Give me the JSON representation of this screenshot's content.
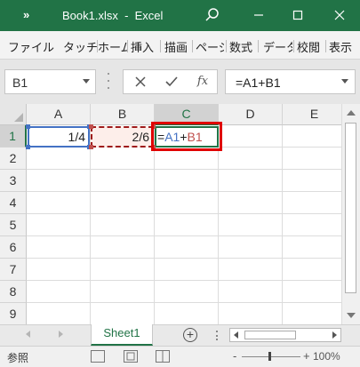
{
  "titlebar": {
    "quick_access_label": "»",
    "title": "Book1.xlsx  -  Excel",
    "search_icon": "search-icon",
    "minimize_icon": "minimize-icon",
    "maximize_icon": "maximize-icon",
    "close_icon": "close-icon",
    "color": "#217346"
  },
  "ribbon": {
    "tabs": [
      "ファイル",
      "タッチ",
      "ホーム",
      "挿入",
      "描画",
      "ページ",
      "数式",
      "データ",
      "校閲",
      "表示"
    ]
  },
  "formula_bar": {
    "name_box": "B1",
    "cancel_icon": "cancel-icon",
    "enter_icon": "check-icon",
    "insert_function_label": "fx",
    "formula": "=A1+B1"
  },
  "grid": {
    "columns": [
      "A",
      "B",
      "C",
      "D",
      "E"
    ],
    "active_column": "C",
    "rows": [
      "1",
      "2",
      "3",
      "4",
      "5",
      "6",
      "7",
      "8",
      "9"
    ],
    "active_row": "1",
    "cells": {
      "A1": "1/4",
      "B1": "2/6",
      "C1_prefix": "=",
      "C1_ref_a": "A1",
      "C1_op": "+",
      "C1_ref_b": "B1"
    },
    "ref_colors": {
      "A1": "#4472c4",
      "B1": "#c0504d"
    },
    "highlight_color": "#e00000"
  },
  "sheet_tabs": {
    "tabs": [
      "Sheet1"
    ],
    "add_sheet_label": "+"
  },
  "status_bar": {
    "mode": "参照",
    "zoom_minus": "-",
    "zoom_plus": "+",
    "zoom_value": "100%",
    "zoom_level_percent": 100
  }
}
